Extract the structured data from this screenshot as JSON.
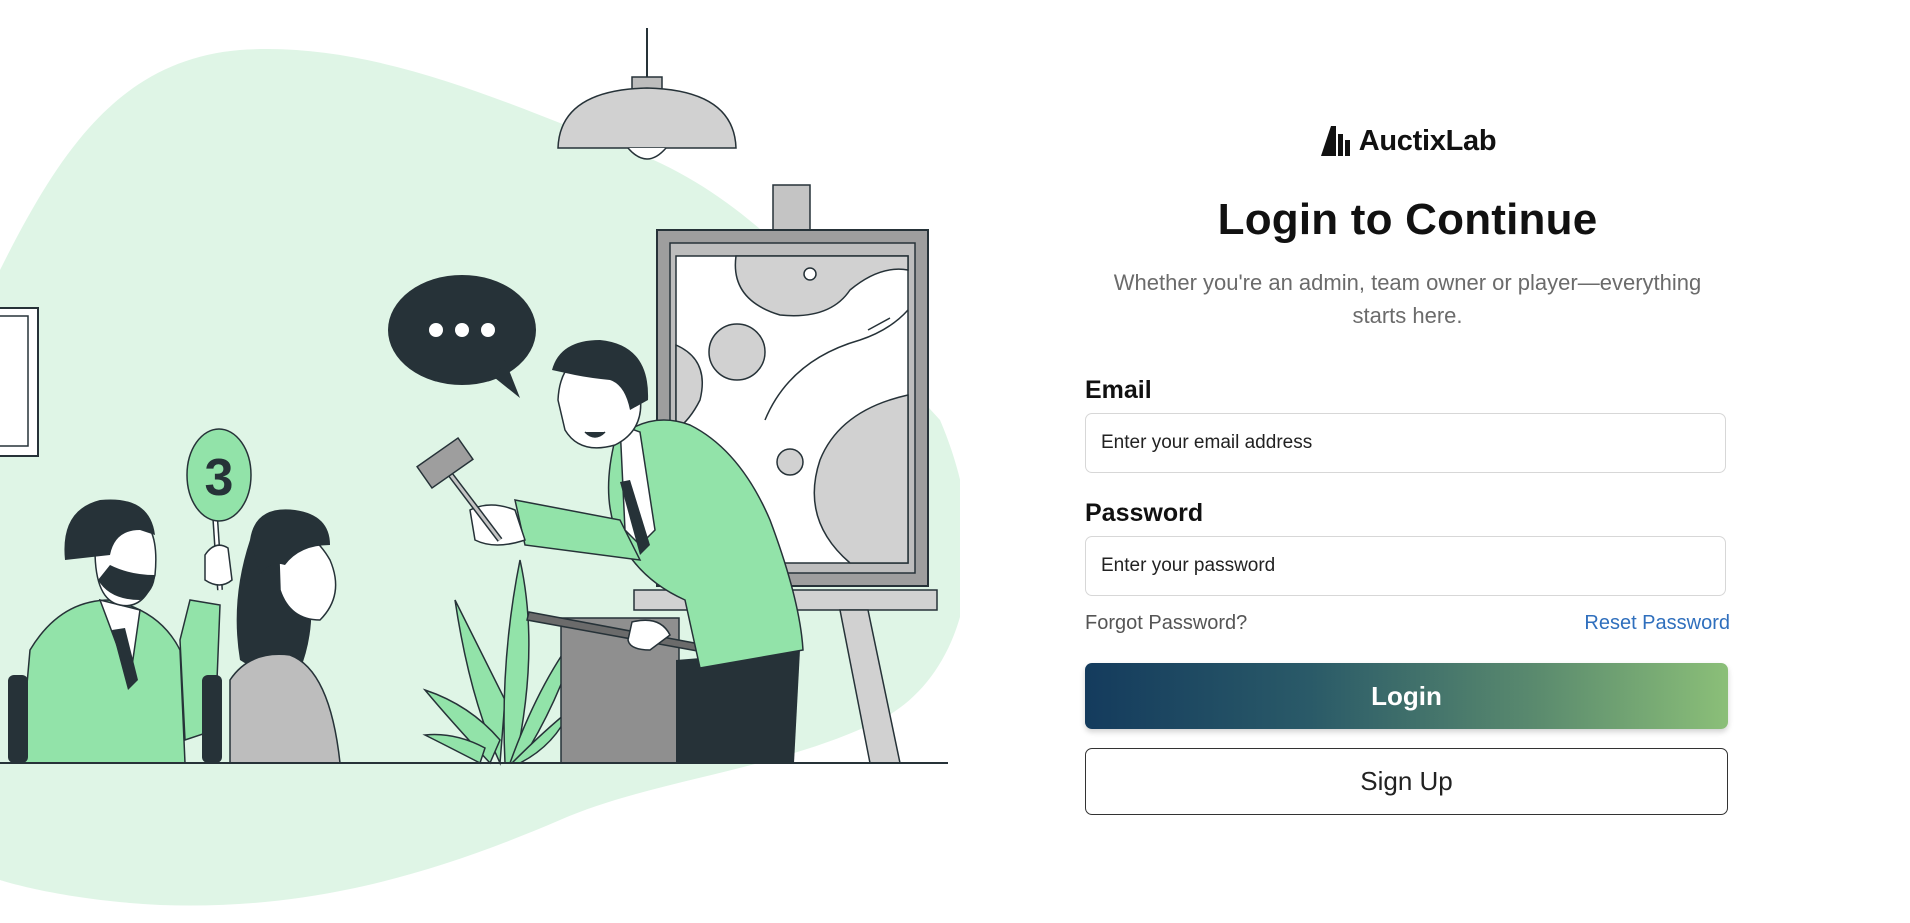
{
  "brand": {
    "name": "AuctixLab"
  },
  "login": {
    "title": "Login to Continue",
    "subtitle": "Whether you're an admin, team owner or player—everything starts here.",
    "email": {
      "label": "Email",
      "placeholder": "Enter your email address",
      "value": ""
    },
    "password": {
      "label": "Password",
      "placeholder": "Enter your password",
      "value": ""
    },
    "forgot_text": "Forgot Password?",
    "reset_link": "Reset Password",
    "login_button": "Login",
    "signup_button": "Sign Up"
  },
  "illustration": {
    "paddle_number": "3"
  },
  "colors": {
    "accent_green": "#92e3a9",
    "dark": "#263238",
    "link": "#2f6fbd",
    "gradient_start": "#143b5d",
    "gradient_end": "#8bbf78"
  }
}
